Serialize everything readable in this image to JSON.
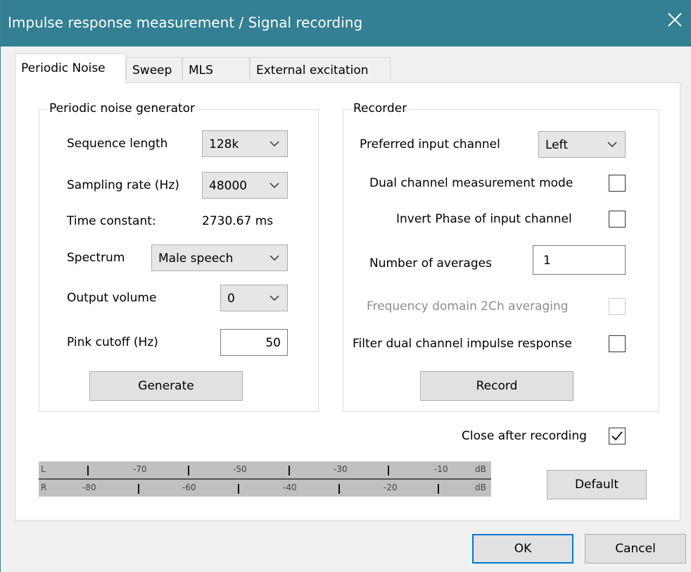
{
  "window": {
    "title": "Impulse response measurement / Signal recording"
  },
  "tabs": [
    {
      "label": "Periodic Noise",
      "active": true
    },
    {
      "label": "Sweep",
      "active": false
    },
    {
      "label": "MLS",
      "active": false
    },
    {
      "label": "External excitation",
      "active": false
    }
  ],
  "generator": {
    "legend": "Periodic noise generator",
    "sequence_length_label": "Sequence length",
    "sequence_length_value": "128k",
    "sampling_rate_label": "Sampling rate (Hz)",
    "sampling_rate_value": "48000",
    "time_constant_label": "Time constant:",
    "time_constant_value": "2730.67 ms",
    "spectrum_label": "Spectrum",
    "spectrum_value": "Male speech",
    "output_volume_label": "Output volume",
    "output_volume_value": "0",
    "pink_cutoff_label": "Pink cutoff (Hz)",
    "pink_cutoff_value": "50",
    "generate_button": "Generate"
  },
  "recorder": {
    "legend": "Recorder",
    "preferred_input_label": "Preferred input channel",
    "preferred_input_value": "Left",
    "dual_channel_label": "Dual channel measurement mode",
    "dual_channel_checked": false,
    "invert_phase_label": "Invert Phase of input channel",
    "invert_phase_checked": false,
    "averages_label": "Number of averages",
    "averages_value": "1",
    "freq_domain_label": "Frequency domain 2Ch averaging",
    "freq_domain_checked": false,
    "freq_domain_enabled": false,
    "filter_label": "Filter dual channel impulse response",
    "filter_checked": false,
    "record_button": "Record"
  },
  "close_after_recording": {
    "label": "Close after recording",
    "checked": true
  },
  "meter": {
    "left_channel": "L",
    "right_channel": "R",
    "left_labels": [
      "-70",
      "-50",
      "-30",
      "-10",
      "dB"
    ],
    "right_labels": [
      "-80",
      "-60",
      "-40",
      "-20",
      "dB"
    ]
  },
  "buttons": {
    "default": "Default",
    "ok": "OK",
    "cancel": "Cancel"
  },
  "icons": {
    "close": "close-icon",
    "chevron": "chevron-down-icon",
    "check": "checkmark-icon"
  }
}
